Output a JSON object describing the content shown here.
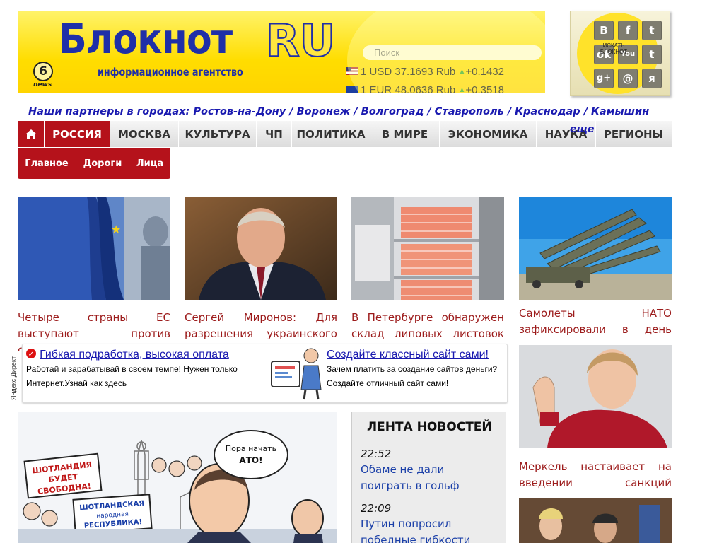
{
  "header": {
    "logo_main": "Блокнот",
    "logo_ru": "RU",
    "logo_sub": "информационное агентство",
    "news_badge": "6",
    "news_label": "news",
    "search_placeholder": "Поиск",
    "rates": [
      {
        "text": "1 USD 37.1693 Rub",
        "change": "+0.1432"
      },
      {
        "text": "1 EUR 48.0636 Rub",
        "change": "+0.3518"
      }
    ]
  },
  "social": {
    "caption": "ИСКАТЬ БЛОКНОТ",
    "buttons": [
      "B",
      "f",
      "t",
      "ok",
      "You",
      "t",
      "g+",
      "@",
      "я"
    ]
  },
  "partners": {
    "label": "Наши партнеры в городах:",
    "cities": "Ростов-на-Дону / Воронеж / Волгоград / Ставрополь / Краснодар / Камышин / Волгодонск /",
    "more": "еще"
  },
  "nav": {
    "items": [
      "РОССИЯ",
      "МОСКВА",
      "КУЛЬТУРА",
      "ЧП",
      "ПОЛИТИКА",
      "В МИРЕ",
      "ЭКОНОМИКА",
      "НАУКА",
      "РЕГИОНЫ"
    ],
    "active": "РОССИЯ"
  },
  "subnav": {
    "items": [
      "Главное",
      "Дороги",
      "Лица"
    ]
  },
  "top_stories": [
    {
      "title": "Четыре страны ЕС выступают против санкций"
    },
    {
      "title": "Сергей Миронов: Для разрешения украинского кризиса нужна"
    },
    {
      "title": "В Петербурге обнаружен склад липовых листовок оппозиционных партий"
    }
  ],
  "ads": {
    "label": "Яндекс.Директ",
    "ad1": {
      "title": "Гибкая подработка, высокая оплата",
      "text": "Работай и зарабатывай в своем темпе! Нужен только Интернет.Узнай как здесь"
    },
    "ad2": {
      "title": "Создайте классный сайт сами!",
      "text": "Зачем платить за создание сайтов деньги? Создайте отличный сайт сами!"
    }
  },
  "cartoon": {
    "sign1": "ШОТЛАНДИЯ БУДЕТ СВОБОДНА!",
    "sign2": "ШОТЛАНДСКАЯ народная РЕСПУБЛИКА!",
    "bubble": "Пора начать АТО!"
  },
  "feed": {
    "title": "ЛЕНТА НОВОСТЕЙ",
    "items": [
      {
        "time": "22:52",
        "text": "Обаме не дали поиграть в гольф"
      },
      {
        "time": "22:09",
        "text": "Путин попросил победные гибкости"
      }
    ]
  },
  "right_column": [
    {
      "title": "Самолеты НАТО зафиксировали в день"
    },
    {
      "title": "Меркель настаивает на введении санкций"
    }
  ],
  "colors": {
    "brand_red": "#b5121b",
    "link_blue": "#1a1ab0",
    "headline_red": "#9c1b1b",
    "banner_yellow": "#ffdd00"
  }
}
